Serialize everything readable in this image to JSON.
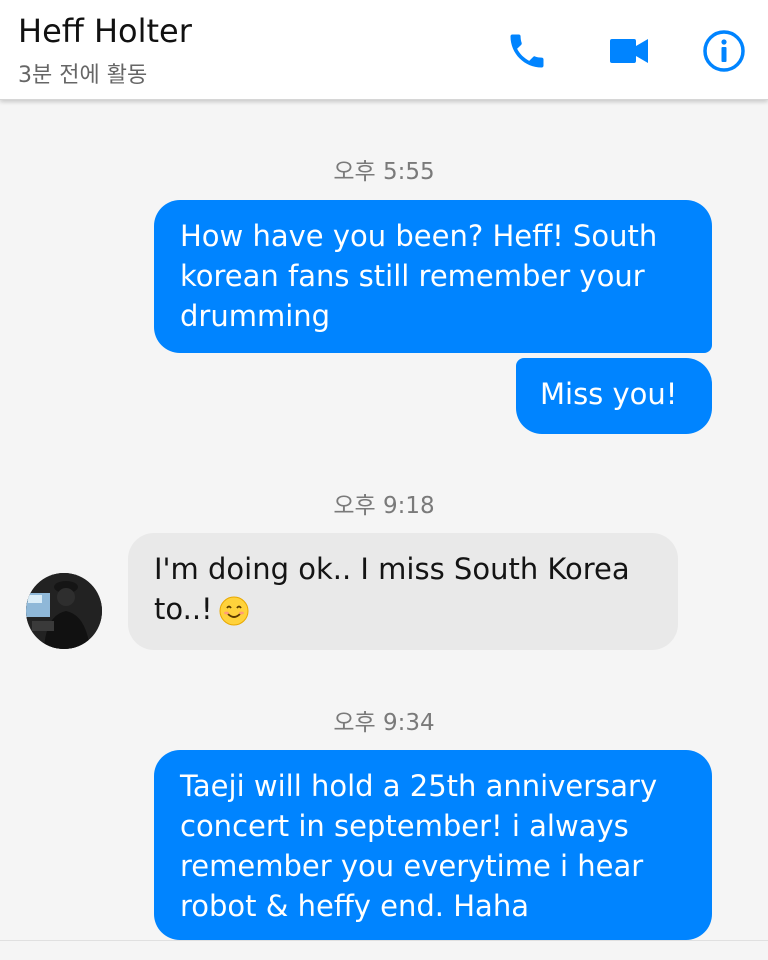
{
  "header": {
    "contact_name": "Heff Holter",
    "status": "3분 전에 활동",
    "icons": [
      "phone-icon",
      "video-camera-icon",
      "info-icon"
    ]
  },
  "colors": {
    "accent": "#0084ff",
    "outgoing_bubble": "#0084ff",
    "incoming_bubble": "#e9e9e9",
    "background": "#f5f5f5"
  },
  "thread": {
    "timestamps": [
      "오후 5:55",
      "오후 9:18",
      "오후 9:34"
    ],
    "messages": [
      {
        "direction": "outgoing",
        "text": "How have you been? Heff! South korean fans still remember your drumming"
      },
      {
        "direction": "outgoing",
        "text": "Miss you!"
      },
      {
        "direction": "incoming",
        "text": "I'm doing ok.. I miss South Korea to..!",
        "emoji": "smiling-face-emoji"
      },
      {
        "direction": "outgoing",
        "text": "Taeji will hold a 25th anniversary concert in september! i always remember you everytime i hear robot & heffy end. Haha"
      }
    ]
  }
}
